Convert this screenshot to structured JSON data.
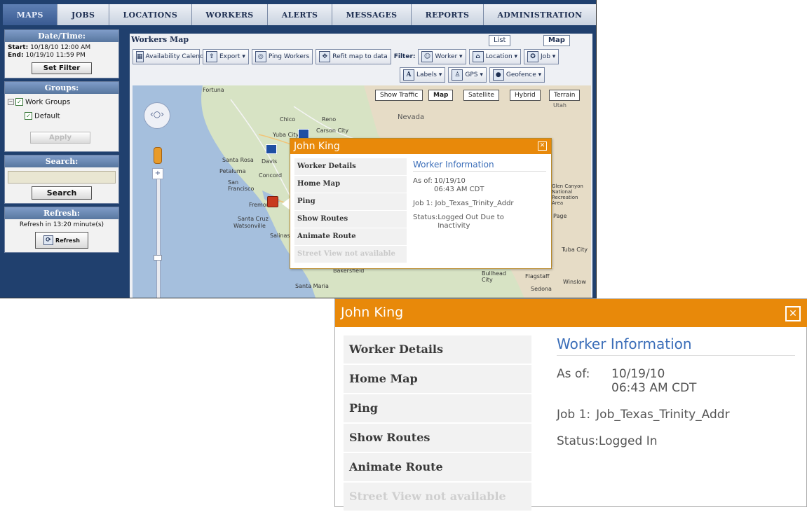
{
  "nav": {
    "tabs": [
      "MAPS",
      "JOBS",
      "LOCATIONS",
      "WORKERS",
      "ALERTS",
      "MESSAGES",
      "REPORTS",
      "ADMINISTRATION"
    ]
  },
  "sidebar": {
    "datetime": {
      "title": "Date/Time:",
      "start_label": "Start:",
      "start_value": "10/18/10 12:00 AM",
      "end_label": "End:",
      "end_value": "10/19/10 11:59 PM",
      "button": "Set Filter"
    },
    "groups": {
      "title": "Groups:",
      "parent": "Work Groups",
      "child": "Default",
      "apply_button": "Apply"
    },
    "search": {
      "title": "Search:",
      "button": "Search"
    },
    "refresh": {
      "title": "Refresh:",
      "text": "Refresh in 13:20 minute(s)",
      "button": "Refresh"
    }
  },
  "main": {
    "title": "Workers Map",
    "view_tabs": {
      "list": "List",
      "map": "Map"
    },
    "toolbar": {
      "availability": "Availability Calendar",
      "export": "Export ▾",
      "ping": "Ping Workers",
      "refit": "Refit map to data",
      "filters_label": "Filter:",
      "worker": "Worker ▾",
      "location": "Location ▾",
      "job": "Job ▾",
      "labels": "Labels ▾",
      "gps": "GPS ▾",
      "geofence": "Geofence ▾"
    },
    "map": {
      "show_traffic": "Show Traffic",
      "types": [
        "Map",
        "Satellite",
        "Hybrid",
        "Terrain"
      ],
      "places": {
        "fortuna": "Fortuna",
        "chico": "Chico",
        "reno": "Reno",
        "nevada": "Nevada",
        "yuba": "Yuba City",
        "carson": "Carson City",
        "santarosa": "Santa Rosa",
        "davis": "Davis",
        "petaluma": "Petaluma",
        "concord": "Concord",
        "sanfrancisco": "San Francisco",
        "fremont": "Fremont",
        "santacruz": "Santa Cruz",
        "watsonville": "Watsonville",
        "salinas": "Salinas",
        "santamaria": "Santa Maria",
        "bakersfield": "Bakersfield",
        "bullhead": "Bullhead City",
        "flagstaff": "Flagstaff",
        "winslow": "Winslow",
        "sedona": "Sedona",
        "tuba": "Tuba City",
        "glencanyon": "Glen Canyon National Recreation Area",
        "page": "Page",
        "utah": "Utah"
      }
    }
  },
  "popup_small": {
    "name": "John King",
    "menu": [
      "Worker Details",
      "Home Map",
      "Ping",
      "Show Routes",
      "Animate Route",
      "Street View not available"
    ],
    "info_title": "Worker Information",
    "asof_label": "As of:",
    "asof_date": "10/19/10",
    "asof_time": "06:43 AM CDT",
    "job_label": "Job 1:",
    "job_value": "Job_Texas_Trinity_Addr",
    "status_label": "Status:",
    "status_value": "Logged Out Due to Inactivity"
  },
  "popup_large": {
    "name": "John King",
    "menu": [
      "Worker Details",
      "Home Map",
      "Ping",
      "Show Routes",
      "Animate Route",
      "Street View not available"
    ],
    "info_title": "Worker Information",
    "asof_label": "As of:",
    "asof_date": "10/19/10",
    "asof_time": "06:43 AM CDT",
    "job_label": "Job 1:",
    "job_value": "Job_Texas_Trinity_Addr",
    "status_label": "Status:",
    "status_value": "Logged In"
  },
  "colors": {
    "popup_header": "#e8890a",
    "app_background": "#20406e",
    "info_title": "#3a6db8"
  }
}
